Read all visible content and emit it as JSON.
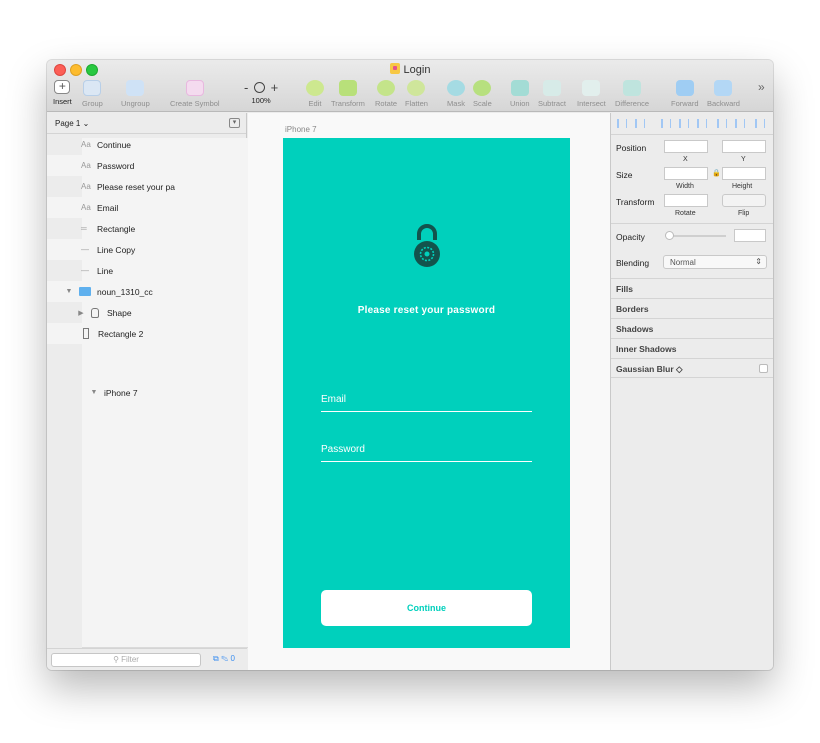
{
  "window": {
    "title": "Login"
  },
  "toolbar": {
    "insert": "Insert",
    "group": "Group",
    "ungroup": "Ungroup",
    "create_symbol": "Create Symbol",
    "zoom_minus": "-",
    "zoom_plus": "+",
    "zoom_level": "100%",
    "edit": "Edit",
    "transform": "Transform",
    "rotate": "Rotate",
    "flatten": "Flatten",
    "mask": "Mask",
    "scale": "Scale",
    "union": "Union",
    "subtract": "Subtract",
    "intersect": "Intersect",
    "difference": "Difference",
    "forward": "Forward",
    "backward": "Backward",
    "more": "»"
  },
  "layers": {
    "page": "Page 1 ⌄",
    "artboard": "iPhone 7",
    "items": [
      {
        "kind": "Aa",
        "label": "Continue"
      },
      {
        "kind": "Aa",
        "label": "Password"
      },
      {
        "kind": "Aa",
        "label": "Please reset your pa"
      },
      {
        "kind": "Aa",
        "label": "Email"
      },
      {
        "kind": "═",
        "label": "Rectangle"
      },
      {
        "kind": "—",
        "label": "Line Copy"
      },
      {
        "kind": "—",
        "label": "Line"
      },
      {
        "kind": "folder",
        "label": "noun_1310_cc"
      },
      {
        "kind": "shape",
        "label": "Shape"
      },
      {
        "kind": "rect",
        "label": "Rectangle 2"
      }
    ],
    "filter_placeholder": "Filter",
    "filter_count": "0"
  },
  "canvas": {
    "artboard_label": "iPhone 7",
    "heading": "Please reset your password",
    "email_placeholder": "Email",
    "password_placeholder": "Password",
    "continue_label": "Continue"
  },
  "inspector": {
    "position": "Position",
    "x": "X",
    "y": "Y",
    "size": "Size",
    "width": "Width",
    "height": "Height",
    "transform": "Transform",
    "rotate": "Rotate",
    "flip": "Flip",
    "opacity": "Opacity",
    "blending": "Blending",
    "blending_value": "Normal",
    "fills": "Fills",
    "borders": "Borders",
    "shadows": "Shadows",
    "inner_shadows": "Inner Shadows",
    "gaussian_blur": "Gaussian Blur ◇"
  },
  "colors": {
    "artboard_bg": "#00d0bc",
    "accent": "#3b8ef0"
  }
}
